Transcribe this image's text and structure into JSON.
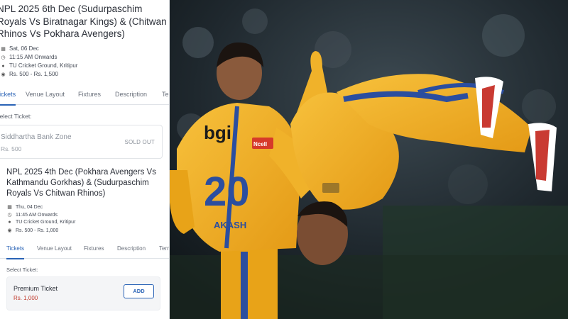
{
  "event1": {
    "title": "NPL 2025 6th Dec (Sudurpaschim Royals Vs Biratnagar Kings) & (Chitwan Rhinos Vs Pokhara Avengers)",
    "date": "Sat, 06 Dec",
    "time": "11:15 AM Onwards",
    "venue": "TU Cricket Ground, Kritipur",
    "price_range": "Rs. 500 - Rs. 1,500",
    "tabs": [
      "Tickets",
      "Venue Layout",
      "Fixtures",
      "Description",
      "Terms"
    ],
    "select_label": "Select Ticket:",
    "ticket": {
      "name": "Siddhartha Bank Zone",
      "price": "Rs. 500",
      "status": "SOLD OUT"
    }
  },
  "event2": {
    "title": "NPL 2025 4th Dec (Pokhara Avengers Vs Kathmandu Gorkhas) & (Sudurpaschim Royals Vs Chitwan Rhinos)",
    "date": "Thu, 04 Dec",
    "time": "11:45 AM Onwards",
    "venue": "TU Cricket Ground, Kritipur",
    "price_range": "Rs. 500 - Rs. 1,000",
    "tabs": [
      "Tickets",
      "Venue Layout",
      "Fixtures",
      "Description",
      "Terms"
    ],
    "select_label": "Select Ticket:",
    "ticket": {
      "name": "Premium Ticket",
      "price": "Rs. 1,000",
      "action": "ADD"
    }
  },
  "photo": {
    "jersey_number": "20",
    "jersey_sponsor": "bgi",
    "jersey_name": "AKASH",
    "sponsor_badge": "Ncell"
  },
  "colors": {
    "accent": "#2a63b6",
    "price_red": "#c0392b",
    "jersey": "#f3b021",
    "stripe": "#2b4e9f"
  },
  "icons": [
    "calendar-icon",
    "clock-icon",
    "location-icon",
    "price-icon"
  ]
}
